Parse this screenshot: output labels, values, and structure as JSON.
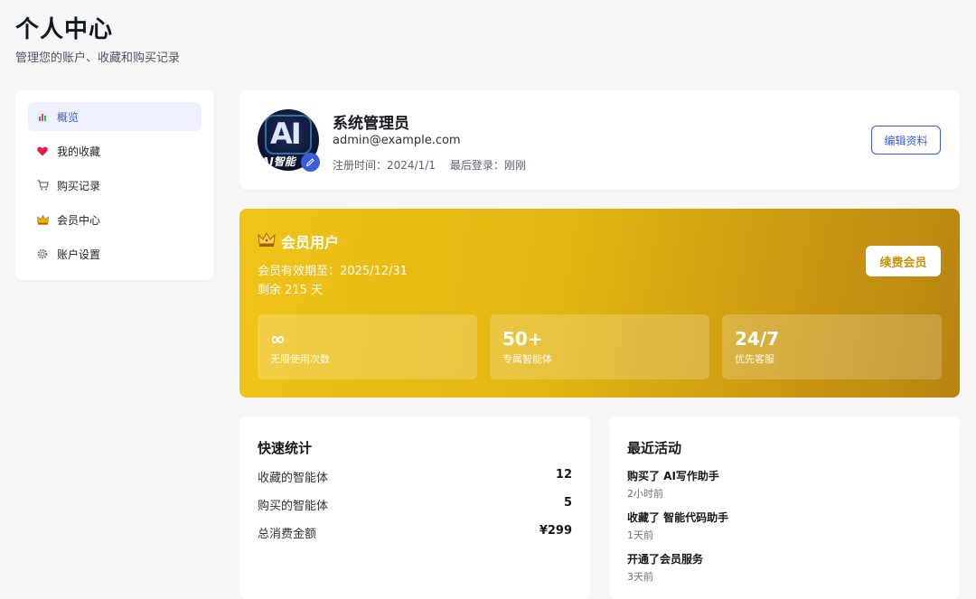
{
  "header": {
    "title": "个人中心",
    "subtitle": "管理您的账户、收藏和购买记录"
  },
  "sidebar": {
    "items": [
      {
        "label": "概览",
        "icon": "bar-chart-icon"
      },
      {
        "label": "我的收藏",
        "icon": "heart-icon"
      },
      {
        "label": "购买记录",
        "icon": "cart-icon"
      },
      {
        "label": "会员中心",
        "icon": "crown-icon"
      },
      {
        "label": "账户设置",
        "icon": "gear-icon"
      }
    ],
    "active_index": 0
  },
  "profile": {
    "avatar_text": "AI智能",
    "name": "系统管理员",
    "email": "admin@example.com",
    "registered": "注册时间：2024/1/1",
    "last_login": "最后登录：刚刚",
    "edit_button": "编辑资料"
  },
  "membership": {
    "title": "会员用户",
    "expiry": "会员有效期至：2025/12/31",
    "remaining": "剩余 215 天",
    "renew_button": "续费会员",
    "features": [
      {
        "value": "∞",
        "label": "无限使用次数"
      },
      {
        "value": "50+",
        "label": "专属智能体"
      },
      {
        "value": "24/7",
        "label": "优先客服"
      }
    ],
    "colors": {
      "gradient_start": "#f0c419",
      "gradient_end": "#b78310"
    }
  },
  "stats": {
    "title": "快速统计",
    "rows": [
      {
        "label": "收藏的智能体",
        "value": "12"
      },
      {
        "label": "购买的智能体",
        "value": "5"
      },
      {
        "label": "总消费金额",
        "value": "¥299"
      }
    ]
  },
  "activity": {
    "title": "最近活动",
    "items": [
      {
        "action": "购买了 AI写作助手",
        "time": "2小时前"
      },
      {
        "action": "收藏了 智能代码助手",
        "time": "1天前"
      },
      {
        "action": "开通了会员服务",
        "time": "3天前"
      }
    ]
  },
  "colors": {
    "accent": "#3b5bdb",
    "background": "#f5f6f8"
  }
}
